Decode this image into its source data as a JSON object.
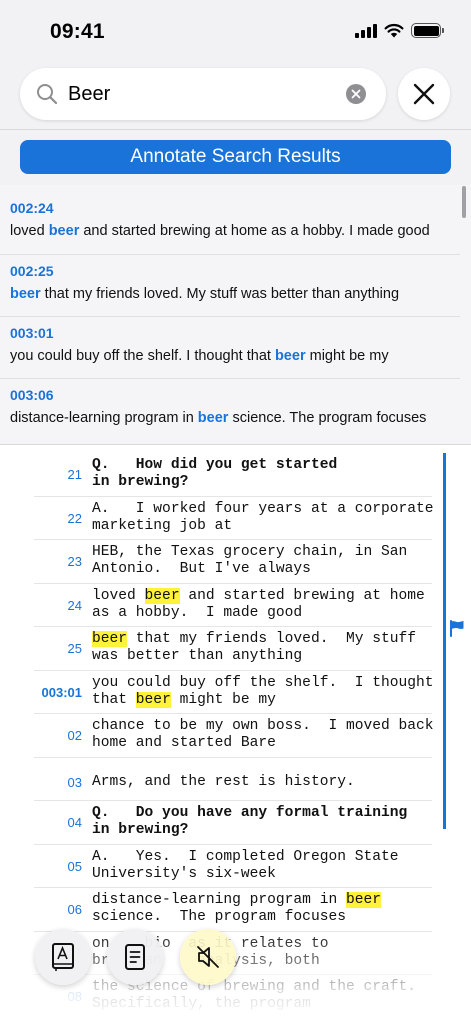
{
  "status_bar": {
    "time": "09:41"
  },
  "search": {
    "value": "Beer",
    "placeholder": "Search"
  },
  "annotate_button": {
    "label": "Annotate Search Results"
  },
  "results": [
    {
      "time": "002:24",
      "before": "loved ",
      "match": "beer",
      "after": " and started brewing at home as a hobby.  I made good"
    },
    {
      "time": "002:25",
      "before": "",
      "match": "beer",
      "after": " that my friends loved.  My stuff was better than anything"
    },
    {
      "time": "003:01",
      "before": "you could buy off the shelf.  I thought that ",
      "match": "beer",
      "after": " might be my"
    },
    {
      "time": "003:06",
      "before": "distance-learning program in ",
      "match": "beer",
      "after": " science.  The program focuses"
    }
  ],
  "transcript": [
    {
      "num": "21",
      "bold": true,
      "l1": [
        "Q.   How did you get started"
      ],
      "l2": [
        "in brewing?"
      ]
    },
    {
      "num": "22",
      "bold": false,
      "l1": [
        "A.   I worked four years at a corporate"
      ],
      "l2": [
        "marketing job at"
      ]
    },
    {
      "num": "23",
      "bold": false,
      "l1": [
        "HEB, the Texas grocery chain, in San"
      ],
      "l2": [
        "Antonio.  But I've always"
      ]
    },
    {
      "num": "24",
      "bold": false,
      "l1": [
        "loved ",
        "beer",
        " and started brewing at home"
      ],
      "l2": [
        "as a hobby.  I made good"
      ]
    },
    {
      "num": "25",
      "bold": false,
      "l1": [
        "",
        "beer",
        " that my friends loved.  My stuff"
      ],
      "l2": [
        "was better than anything"
      ]
    },
    {
      "num": "003:01",
      "bold": false,
      "l1": [
        "you could buy off the shelf.  I thought"
      ],
      "l2": [
        "that ",
        "beer",
        " might be my"
      ]
    },
    {
      "num": "02",
      "bold": false,
      "l1": [
        "chance to be my own boss.  I moved back"
      ],
      "l2": [
        "home and started Bare"
      ]
    },
    {
      "num": "03",
      "bold": false,
      "l1": [
        "Arms, and the rest is history."
      ],
      "l2": [
        ""
      ]
    },
    {
      "num": "04",
      "bold": true,
      "l1": [
        "Q.   Do you have any formal training"
      ],
      "l2": [
        "in brewing?"
      ]
    },
    {
      "num": "05",
      "bold": false,
      "l1": [
        "A.   Yes.  I completed Oregon State"
      ],
      "l2": [
        "University's six-week"
      ]
    },
    {
      "num": "06",
      "bold": false,
      "l1": [
        "distance-learning program in ",
        "beer"
      ],
      "l2": [
        "science.  The program focuses"
      ]
    },
    {
      "num": "07",
      "bold": false,
      "l1": [
        "on    bio  as it relates to"
      ],
      "l2": [
        "br    an    analysis, both"
      ]
    },
    {
      "num": "08",
      "bold": false,
      "l1": [
        "the science of brewing and the craft."
      ],
      "l2": [
        "Specifically, the program"
      ]
    }
  ],
  "toolbar": {
    "icons": [
      "exhibit-book-icon",
      "document-icon",
      "mute-icon"
    ]
  },
  "colors": {
    "accent": "#1a73d9",
    "highlight": "#fff23a"
  }
}
